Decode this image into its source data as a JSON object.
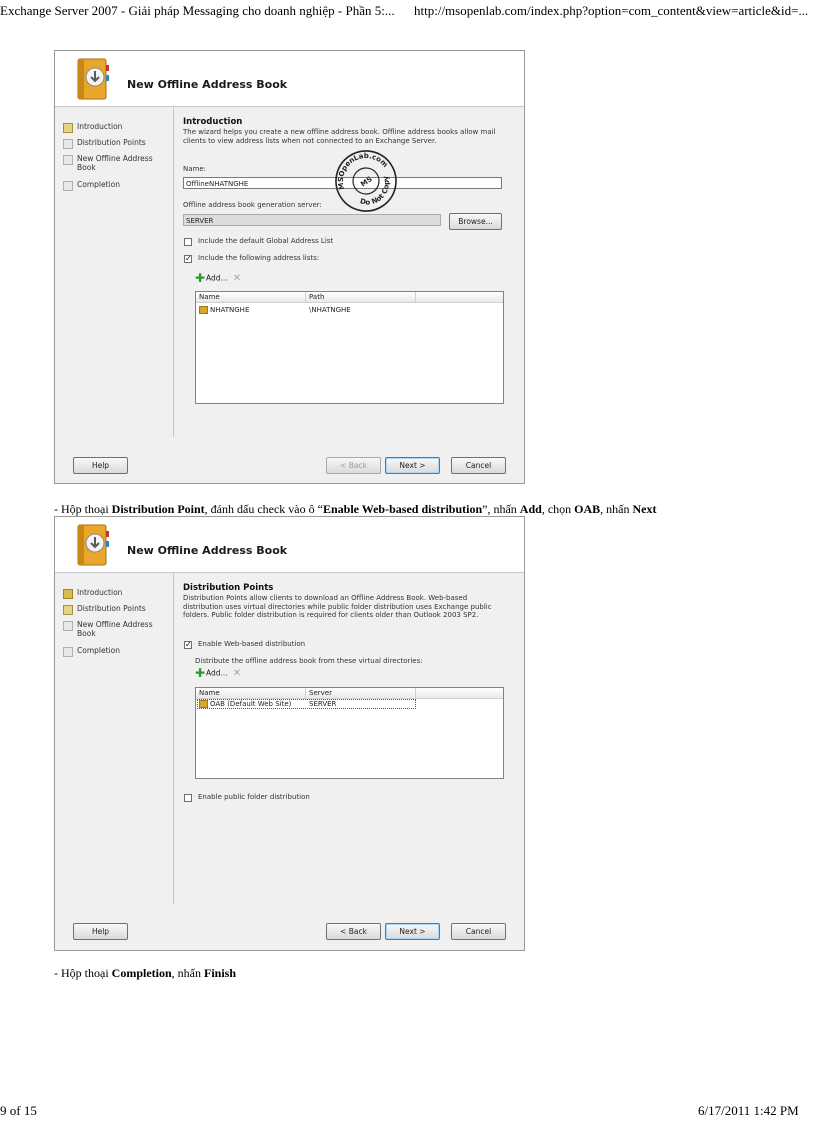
{
  "page_header": {
    "title": "Exchange Server 2007 - Giải pháp Messaging cho doanh nghiệp - Phần 5:...",
    "url": "http://msopenlab.com/index.php?option=com_content&view=article&id=..."
  },
  "page_footer": {
    "page": "9 of 15",
    "datetime": "6/17/2011 1:42 PM"
  },
  "wizard1": {
    "title": "New Offline Address Book",
    "steps": [
      "Introduction",
      "Distribution Points",
      "New Offline Address Book",
      "Completion"
    ],
    "section_title": "Introduction",
    "description": "The wizard helps you create a new offline address book. Offline address books allow mail clients to view address lists when not connected to an Exchange Server.",
    "name_label": "Name:",
    "name_value": "OfflineNHATNGHE",
    "server_label": "Offline address book generation server:",
    "server_value": "SERVER",
    "browse_label": "Browse...",
    "gal_checkbox_label": "Include the default Global Address List",
    "gal_checked": false,
    "lists_checkbox_label": "Include the following address lists:",
    "lists_checked": true,
    "add_label": "Add...",
    "columns": [
      "Name",
      "Path"
    ],
    "rows": [
      {
        "name": "NHATNGHE",
        "path": "\\NHATNGHE"
      }
    ],
    "stamp_text": "MSOpenLab.com",
    "stamp_subtext": "Do Not Copy",
    "stamp_inner": "MS",
    "buttons": {
      "help": "Help",
      "back": "< Back",
      "next": "Next >",
      "cancel": "Cancel"
    }
  },
  "caption1": {
    "prefix": "- Hộp thoại ",
    "b1": "Distribution Point",
    "t1": ", đánh dấu check vào ô “",
    "b2": "Enable Web-based distribution",
    "t2": "”, nhấn ",
    "b3": "Add",
    "t3": ", chọn ",
    "b4": "OAB",
    "t4": ", nhấn ",
    "b5": "Next"
  },
  "wizard2": {
    "title": "New Offline Address Book",
    "steps": [
      "Introduction",
      "Distribution Points",
      "New Offline Address Book",
      "Completion"
    ],
    "section_title": "Distribution Points",
    "description": "Distribution Points allow clients to download an Offline Address Book. Web-based distribution uses virtual directories while public folder distribution uses Exchange public folders. Public folder distribution is required for clients older than Outlook 2003 SP2.",
    "web_checkbox_label": "Enable Web-based distribution",
    "web_checked": true,
    "vdir_label": "Distribute the offline address book from these virtual directories:",
    "add_label": "Add...",
    "columns": [
      "Name",
      "Server"
    ],
    "rows": [
      {
        "name": "OAB (Default Web Site)",
        "server": "SERVER"
      }
    ],
    "pf_checkbox_label": "Enable public folder distribution",
    "pf_checked": false,
    "buttons": {
      "help": "Help",
      "back": "< Back",
      "next": "Next >",
      "cancel": "Cancel"
    }
  },
  "caption2": {
    "prefix": "- Hộp thoại ",
    "b1": "Completion",
    "t1": ", nhấn ",
    "b2": "Finish"
  }
}
